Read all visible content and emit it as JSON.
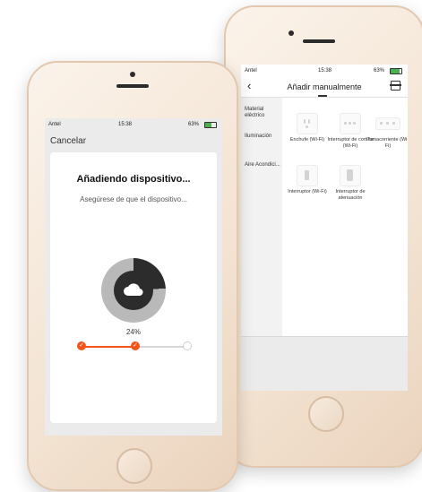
{
  "back_phone": {
    "status": {
      "carrier": "Antel",
      "time": "15:38",
      "battery": "63%"
    },
    "header": {
      "title": "Añadir manualmente"
    },
    "categories": [
      {
        "label": "Material eléctrico"
      },
      {
        "label": "Iluminación"
      },
      {
        "label": "Aire Acondici..."
      }
    ],
    "devices": [
      {
        "label": "Enchufe (Wi-Fi)",
        "icon": "plug-icon"
      },
      {
        "label": "Interruptor de cortina (Wi-Fi)",
        "icon": "curtain-switch-icon"
      },
      {
        "label": "Tomacorriente (Wi-Fi)",
        "icon": "power-strip-icon"
      },
      {
        "label": "Interruptor (Wi-Fi)",
        "icon": "switch-icon"
      },
      {
        "label": "Interruptor de atenuación",
        "icon": "dimmer-icon"
      }
    ]
  },
  "front_phone": {
    "status": {
      "carrier": "Antel",
      "time": "15:38",
      "battery": "63%"
    },
    "cancel_label": "Cancelar",
    "title": "Añadiendo dispositivo...",
    "subtitle": "Asegúrese de que el dispositivo...",
    "progress": {
      "percent": 24,
      "percent_label": "24%"
    },
    "steps": [
      {
        "state": "done"
      },
      {
        "state": "done"
      },
      {
        "state": "pending"
      }
    ],
    "colors": {
      "accent": "#f2541b",
      "ring_dark": "#2c2c2c",
      "ring_light": "#b9b9b9"
    }
  }
}
